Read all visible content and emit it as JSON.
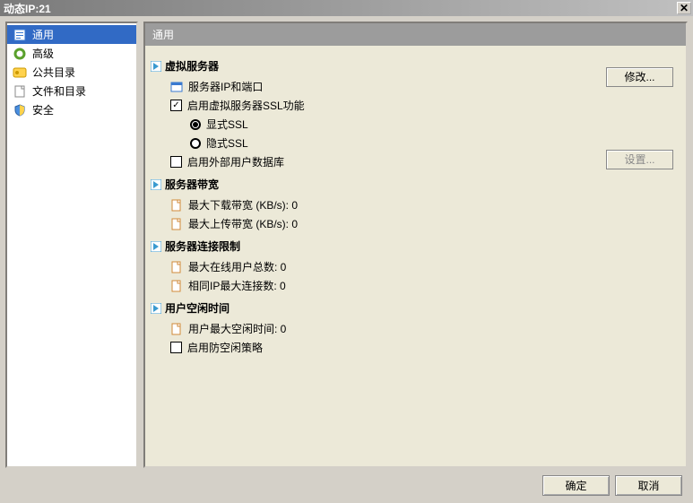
{
  "window": {
    "title": "动态IP:21"
  },
  "sidebar": {
    "items": [
      {
        "label": "通用",
        "selected": true
      },
      {
        "label": "高级",
        "selected": false
      },
      {
        "label": "公共目录",
        "selected": false
      },
      {
        "label": "文件和目录",
        "selected": false
      },
      {
        "label": "安全",
        "selected": false
      }
    ]
  },
  "content": {
    "heading": "通用",
    "buttons": {
      "modify": "修改...",
      "settings": "设置..."
    },
    "sections": {
      "virtual_server": {
        "title": "虚拟服务器",
        "server_ip_port": "服务器IP和端口",
        "enable_ssl": "启用虚拟服务器SSL功能",
        "explicit_ssl": "显式SSL",
        "implicit_ssl": "隐式SSL",
        "enable_ext_db": "启用外部用户数据库"
      },
      "bandwidth": {
        "title": "服务器带宽",
        "max_download": "最大下载带宽 (KB/s): 0",
        "max_upload": "最大上传带宽 (KB/s): 0"
      },
      "connection_limit": {
        "title": "服务器连接限制",
        "max_online": "最大在线用户总数: 0",
        "same_ip": "相同IP最大连接数: 0"
      },
      "idle": {
        "title": "用户空闲时间",
        "max_idle": "用户最大空闲时间: 0",
        "enable_anti_idle": "启用防空闲策略"
      }
    }
  },
  "dialog_buttons": {
    "ok": "确定",
    "cancel": "取消"
  }
}
